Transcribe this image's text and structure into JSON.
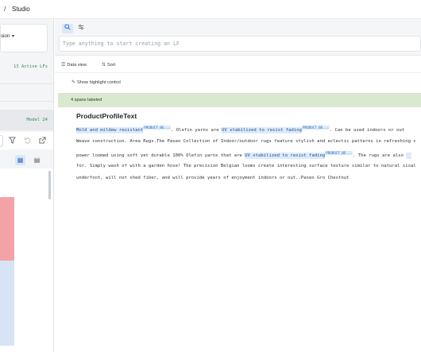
{
  "breadcrumb": {
    "separator": "/",
    "current": "Studio"
  },
  "left_panel": {
    "selector_label": "sion",
    "active_lfs": "13 Active LFs",
    "model_label": "Model 24"
  },
  "search": {
    "placeholder": "Type anything to start creating an LF"
  },
  "viewbar": {
    "data_view": "Data view",
    "sort": "Sort"
  },
  "highlight_control": "Show highlight control",
  "banner": "4 spans labeled",
  "document": {
    "title": "ProductProfileText",
    "tag": "PRODUCT_BE...",
    "line1": {
      "span1": "Mold and mildew resistant",
      "text1": ". Olefin yarns are ",
      "span2": "UV stabilized to resist fading",
      "text2": ". Can be used indoors or out"
    },
    "line2": "Weave construction. Area Rugs.The Paseo Collection of Indoor/outdoor rugs feature stylish and eclectic patterns in refreshing c",
    "line3": {
      "text1": "power loomed using soft yet durable 100% Olefin yarns that are ",
      "span": "UV stabilized to resist fading",
      "text2": ". The rugs are also "
    },
    "line4": "for. Simply wash of with a garden hose! The precision Belgian looms create interesting surface texture similar to natural sisal",
    "line5": "underfoot, will not shed fiber, and will provide years of enjoyment indoors or out..Paseo Gro Chestnut"
  },
  "icons": [
    "search-icon",
    "settings-sliders-icon",
    "data-view-icon",
    "sort-icon",
    "highlight-icon",
    "filter-icon",
    "undo-icon",
    "export-icon",
    "grid-view-icon",
    "table-view-icon",
    "chevron-down-icon"
  ],
  "colors": {
    "accent": "#2f6fca",
    "banner": "#d9e8cf",
    "span_highlight": "#dceafb",
    "success_text": "#3c8a5b",
    "chart_pink": "#f3a3a8",
    "chart_blue": "#d6e4f6"
  }
}
